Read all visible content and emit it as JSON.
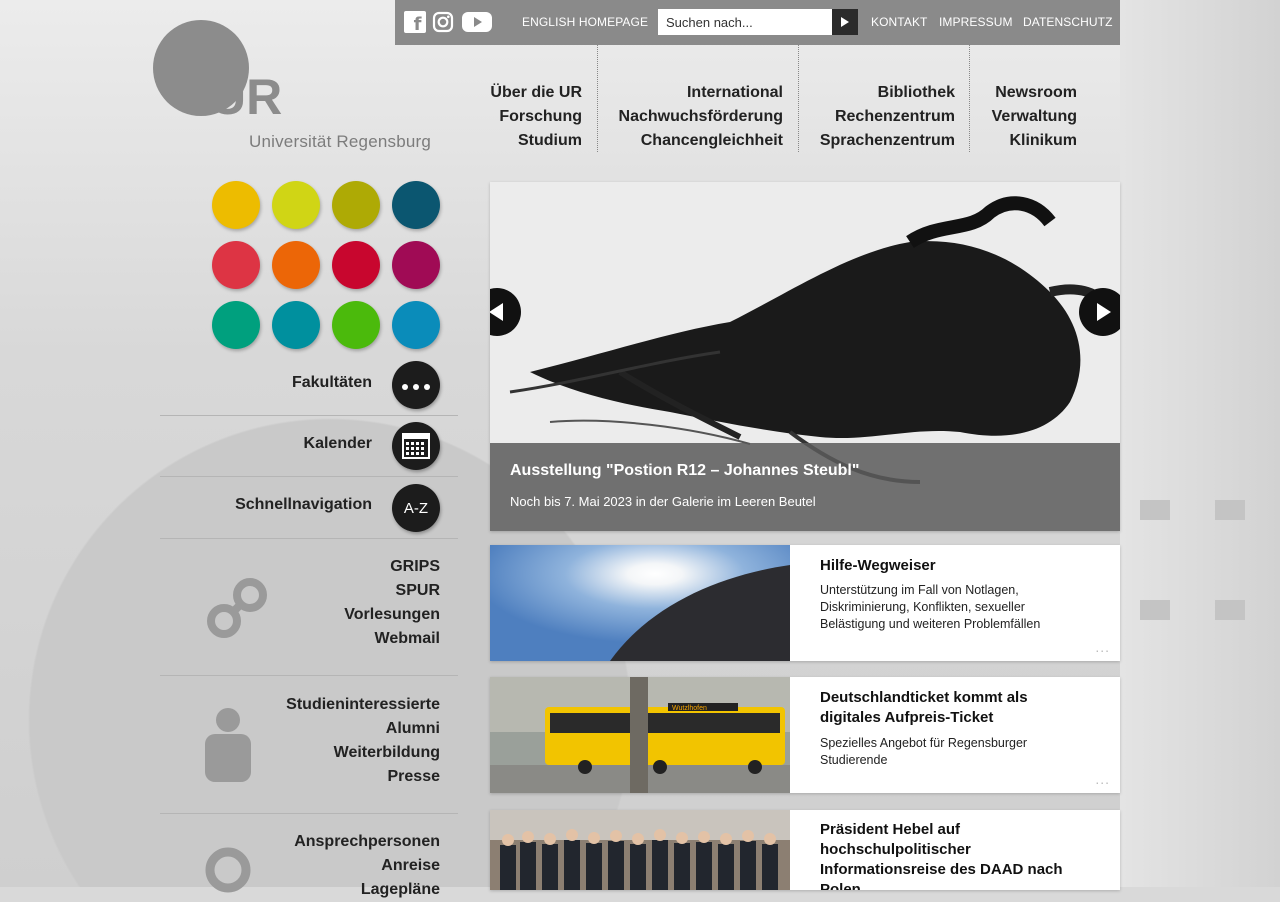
{
  "topbar": {
    "social": [
      "facebook-icon",
      "instagram-icon",
      "youtube-icon"
    ],
    "english_link": "ENGLISH HOMEPAGE",
    "search_placeholder": "Suchen nach...",
    "links": [
      "KONTAKT",
      "IMPRESSUM",
      "DATENSCHUTZ"
    ]
  },
  "logo": {
    "letters": "UR",
    "name": "Universität Regensburg"
  },
  "mainnav": {
    "col1": [
      "Über die UR",
      "Forschung",
      "Studium"
    ],
    "col2": [
      "International",
      "Nachwuchsförderung",
      "Chancengleichheit"
    ],
    "col3": [
      "Bibliothek",
      "Rechenzentrum",
      "Sprachenzentrum"
    ],
    "col4": [
      "Newsroom",
      "Verwaltung",
      "Klinikum"
    ]
  },
  "faculty_colors": [
    "#edbc00",
    "#d0d515",
    "#aeaa05",
    "#0b5670",
    "#dd3444",
    "#ec6607",
    "#c8062e",
    "#a00b55",
    "#00a07e",
    "#00909e",
    "#4bba0c",
    "#0a8cba"
  ],
  "side": {
    "fakultaeten": "Fakultäten",
    "kalender": "Kalender",
    "schnellnavigation": "Schnellnavigation",
    "az": "A-Z",
    "tools": [
      "GRIPS",
      "SPUR",
      "Vorlesungen",
      "Webmail"
    ],
    "people": [
      "Studieninteressierte",
      "Alumni",
      "Weiterbildung",
      "Presse"
    ],
    "location": [
      "Ansprechpersonen",
      "Anreise",
      "Lagepläne"
    ]
  },
  "slider": {
    "title": "Ausstellung \"Postion R12 – Johannes Steubl\"",
    "subtitle": "Noch bis 7. Mai 2023 in der Galerie im Leeren Beutel"
  },
  "news": [
    {
      "title": "Hilfe-Wegweiser",
      "text": "Unterstützung im Fall von Notlagen, Diskriminierung, Konflikten, sexueller Belästigung und weiteren Problemfällen"
    },
    {
      "title": "Deutschlandticket kommt als digitales Aufpreis-Ticket",
      "text": "Spezielles Angebot für Regensburger Studierende"
    },
    {
      "title": "Präsident Hebel auf hochschulpolitischer Informationsreise des DAAD nach Polen",
      "text": ""
    }
  ],
  "bus_sign": "Wutzlhofen",
  "more_label": "..."
}
